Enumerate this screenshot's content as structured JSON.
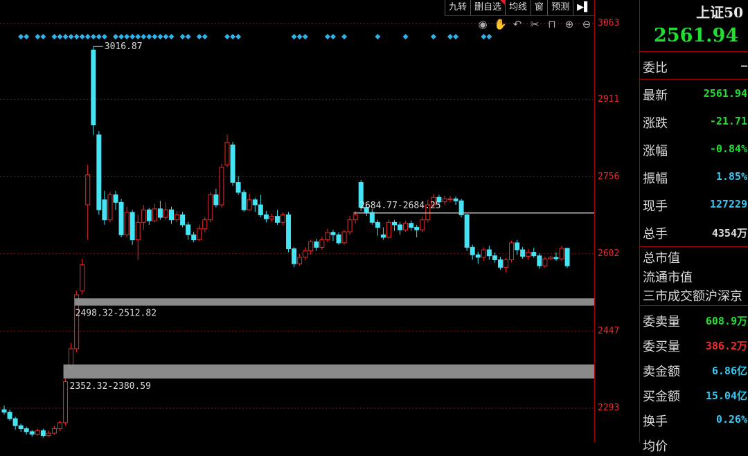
{
  "toolbar": {
    "items": [
      "九转",
      "删自选",
      "均线",
      "窗",
      "预测"
    ],
    "arrow_icon": "collapse-right-icon"
  },
  "tool_icons": [
    "eye-icon",
    "hand-icon",
    "undo-icon",
    "scissors-icon",
    "lock-icon",
    "zoom-in-icon",
    "zoom-out-icon"
  ],
  "sidebar": {
    "name": "上证50",
    "price": "2561.94",
    "weibi_label": "委比",
    "weibi_value": "–",
    "stats": [
      {
        "label": "最新",
        "value": "2561.94",
        "color": "green"
      },
      {
        "label": "涨跌",
        "value": "-21.71",
        "color": "green"
      },
      {
        "label": "涨幅",
        "value": "-0.84%",
        "color": "green"
      },
      {
        "label": "振幅",
        "value": "1.85%",
        "color": "cyan"
      },
      {
        "label": "现手",
        "value": "127229",
        "color": "cyan"
      },
      {
        "label": "总手",
        "value": "4354万",
        "color": "white"
      }
    ],
    "market_lines": [
      "总市值",
      "流通市值",
      "三市成交额沪深京"
    ],
    "trade": [
      {
        "label": "委卖量",
        "value": "608.9万",
        "color": "green"
      },
      {
        "label": "委买量",
        "value": "386.2万",
        "color": "red"
      },
      {
        "label": "卖金额",
        "value": "6.86亿",
        "color": "cyan"
      },
      {
        "label": "买金额",
        "value": "15.04亿",
        "color": "cyan"
      },
      {
        "label": "换手",
        "value": "0.26%",
        "color": "cyan"
      },
      {
        "label": "均价",
        "value": "",
        "color": "white"
      }
    ]
  },
  "chart_data": {
    "type": "candlestick",
    "y_axis": {
      "ticks": [
        3063,
        2911,
        2756,
        2602,
        2447,
        2293
      ],
      "range": [
        2225,
        3110
      ]
    },
    "annotations": {
      "peak_label": "3016.87",
      "gap_labels": [
        "2498.32-2512.82",
        "2352.32-2380.59",
        "2684.77-2684.25"
      ]
    },
    "gaps": [
      {
        "low": 2498.32,
        "high": 2512.82
      },
      {
        "low": 2352.32,
        "high": 2380.59
      },
      {
        "low": 2684.25,
        "high": 2684.77
      }
    ],
    "colors": {
      "up": "#ee2a2a",
      "down": "#44e4f4",
      "grid": "#8a1a1a",
      "gap": "#999999"
    },
    "candles": [
      [
        2290,
        2285,
        2298,
        2280
      ],
      [
        2285,
        2272,
        2290,
        2268
      ],
      [
        2272,
        2258,
        2276,
        2250
      ],
      [
        2258,
        2252,
        2262,
        2246
      ],
      [
        2252,
        2246,
        2256,
        2240
      ],
      [
        2246,
        2241,
        2250,
        2236
      ],
      [
        2241,
        2248,
        2252,
        2238
      ],
      [
        2248,
        2238,
        2252,
        2234
      ],
      [
        2238,
        2243,
        2248,
        2236
      ],
      [
        2243,
        2252,
        2257,
        2240
      ],
      [
        2252,
        2264,
        2268,
        2247
      ],
      [
        2264,
        2346,
        2352,
        2258
      ],
      [
        2374,
        2412,
        2424,
        2370
      ],
      [
        2412,
        2520,
        2528,
        2405
      ],
      [
        2528,
        2580,
        2592,
        2520
      ],
      [
        2700,
        2760,
        2780,
        2630
      ],
      [
        3010,
        2860,
        3016.87,
        2840
      ],
      [
        2840,
        2690,
        2848,
        2680
      ],
      [
        2710,
        2670,
        2728,
        2660
      ],
      [
        2670,
        2720,
        2726,
        2665
      ],
      [
        2720,
        2705,
        2728,
        2690
      ],
      [
        2705,
        2640,
        2712,
        2635
      ],
      [
        2640,
        2685,
        2696,
        2635
      ],
      [
        2685,
        2630,
        2690,
        2620
      ],
      [
        2630,
        2665,
        2680,
        2590
      ],
      [
        2665,
        2690,
        2700,
        2650
      ],
      [
        2690,
        2668,
        2694,
        2660
      ],
      [
        2668,
        2692,
        2702,
        2665
      ],
      [
        2692,
        2675,
        2708,
        2670
      ],
      [
        2675,
        2690,
        2705,
        2670
      ],
      [
        2690,
        2670,
        2696,
        2662
      ],
      [
        2670,
        2680,
        2687,
        2665
      ],
      [
        2680,
        2660,
        2686,
        2655
      ],
      [
        2660,
        2640,
        2666,
        2630
      ],
      [
        2640,
        2630,
        2646,
        2625
      ],
      [
        2630,
        2652,
        2660,
        2627
      ],
      [
        2652,
        2670,
        2676,
        2645
      ],
      [
        2670,
        2720,
        2726,
        2665
      ],
      [
        2720,
        2700,
        2732,
        2695
      ],
      [
        2700,
        2775,
        2782,
        2695
      ],
      [
        2780,
        2825,
        2840,
        2775
      ],
      [
        2820,
        2745,
        2826,
        2738
      ],
      [
        2745,
        2725,
        2758,
        2720
      ],
      [
        2725,
        2690,
        2730,
        2686
      ],
      [
        2690,
        2710,
        2722,
        2688
      ],
      [
        2710,
        2700,
        2714,
        2686
      ],
      [
        2700,
        2680,
        2720,
        2675
      ],
      [
        2680,
        2672,
        2688,
        2665
      ],
      [
        2672,
        2677,
        2682,
        2666
      ],
      [
        2677,
        2665,
        2690,
        2660
      ],
      [
        2665,
        2680,
        2685,
        2660
      ],
      [
        2680,
        2612,
        2686,
        2605
      ],
      [
        2612,
        2582,
        2615,
        2575
      ],
      [
        2582,
        2595,
        2602,
        2578
      ],
      [
        2595,
        2608,
        2615,
        2590
      ],
      [
        2608,
        2626,
        2630,
        2600
      ],
      [
        2626,
        2615,
        2632,
        2608
      ],
      [
        2615,
        2630,
        2636,
        2610
      ],
      [
        2630,
        2645,
        2652,
        2625
      ],
      [
        2645,
        2640,
        2650,
        2628
      ],
      [
        2640,
        2624,
        2645,
        2620
      ],
      [
        2624,
        2646,
        2650,
        2620
      ],
      [
        2646,
        2670,
        2678,
        2640
      ],
      [
        2670,
        2680,
        2688,
        2662
      ],
      [
        2745,
        2695,
        2750,
        2688
      ],
      [
        2695,
        2685,
        2700,
        2678
      ],
      [
        2685,
        2665,
        2692,
        2660
      ],
      [
        2665,
        2655,
        2670,
        2638
      ],
      [
        2640,
        2635,
        2655,
        2630
      ],
      [
        2635,
        2665,
        2671,
        2632
      ],
      [
        2665,
        2660,
        2670,
        2648
      ],
      [
        2660,
        2650,
        2666,
        2640
      ],
      [
        2650,
        2663,
        2668,
        2646
      ],
      [
        2663,
        2655,
        2669,
        2648
      ],
      [
        2655,
        2650,
        2660,
        2635
      ],
      [
        2650,
        2670,
        2676,
        2645
      ],
      [
        2670,
        2700,
        2710,
        2665
      ],
      [
        2700,
        2715,
        2722,
        2695
      ],
      [
        2715,
        2706,
        2720,
        2700
      ],
      [
        2706,
        2712,
        2718,
        2700
      ],
      [
        2712,
        2712,
        2718,
        2705
      ],
      [
        2712,
        2708,
        2717,
        2700
      ],
      [
        2708,
        2680,
        2712,
        2675
      ],
      [
        2680,
        2615,
        2682,
        2608
      ],
      [
        2615,
        2600,
        2620,
        2590
      ],
      [
        2600,
        2595,
        2606,
        2582
      ],
      [
        2595,
        2610,
        2615,
        2588
      ],
      [
        2610,
        2598,
        2618,
        2590
      ],
      [
        2598,
        2590,
        2605,
        2584
      ],
      [
        2590,
        2575,
        2596,
        2570
      ],
      [
        2575,
        2590,
        2594,
        2565
      ],
      [
        2590,
        2624,
        2628,
        2585
      ],
      [
        2624,
        2610,
        2630,
        2600
      ],
      [
        2610,
        2597,
        2616,
        2592
      ],
      [
        2597,
        2605,
        2612,
        2590
      ],
      [
        2605,
        2598,
        2614,
        2594
      ],
      [
        2598,
        2578,
        2603,
        2572
      ],
      [
        2578,
        2592,
        2596,
        2574
      ],
      [
        2592,
        2595,
        2598,
        2590
      ],
      [
        2595,
        2592,
        2605,
        2588
      ],
      [
        2592,
        2613,
        2618,
        2588
      ],
      [
        2613,
        2578,
        2614,
        2574
      ]
    ]
  }
}
